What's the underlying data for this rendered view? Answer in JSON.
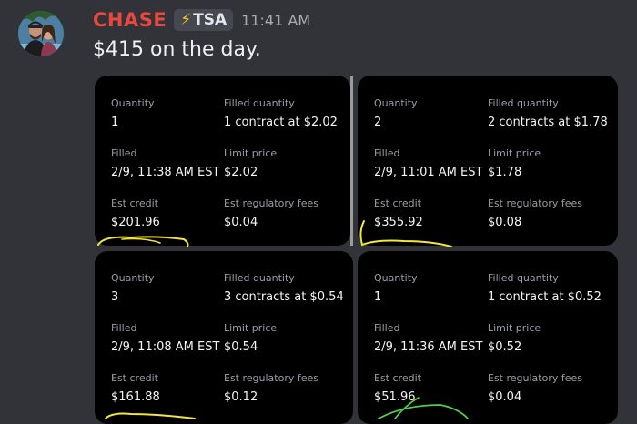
{
  "message": {
    "username": "CHASE",
    "tag_icon": "lightning-bolt-icon",
    "tag_bolt": "⚡",
    "tag_label": "TSA",
    "timestamp": "11:41 AM",
    "text": "$415 on the day."
  },
  "cards": [
    {
      "quantity_label": "Quantity",
      "quantity": "1",
      "filled_quantity_label": "Filled quantity",
      "filled_quantity": "1 contract at $2.02",
      "filled_label": "Filled",
      "filled": "2/9, 11:38 AM EST",
      "limit_label": "Limit price",
      "limit": "$2.02",
      "credit_label": "Est credit",
      "credit": "$201.96",
      "fees_label": "Est regulatory fees",
      "fees": "$0.04"
    },
    {
      "quantity_label": "Quantity",
      "quantity": "2",
      "filled_quantity_label": "Filled quantity",
      "filled_quantity": "2 contracts at $1.78",
      "filled_label": "Filled",
      "filled": "2/9, 11:01 AM EST",
      "limit_label": "Limit price",
      "limit": "$1.78",
      "credit_label": "Est credit",
      "credit": "$355.92",
      "fees_label": "Est regulatory fees",
      "fees": "$0.08"
    },
    {
      "quantity_label": "Quantity",
      "quantity": "3",
      "filled_quantity_label": "Filled quantity",
      "filled_quantity": "3 contracts at $0.54",
      "filled_label": "Filled",
      "filled": "2/9, 11:08 AM EST",
      "limit_label": "Limit price",
      "limit": "$0.54",
      "credit_label": "Est credit",
      "credit": "$161.88",
      "fees_label": "Est regulatory fees",
      "fees": "$0.12"
    },
    {
      "quantity_label": "Quantity",
      "quantity": "1",
      "filled_quantity_label": "Filled quantity",
      "filled_quantity": "1 contract at $0.52",
      "filled_label": "Filled",
      "filled": "2/9, 11:36 AM EST",
      "limit_label": "Limit price",
      "limit": "$0.52",
      "credit_label": "Est credit",
      "credit": "$51.96",
      "fees_label": "Est regulatory fees",
      "fees": "$0.04"
    }
  ],
  "colors": {
    "username": "#e8473f",
    "background": "#313338",
    "card_background": "#000000",
    "highlight_yellow": "#f1e73c",
    "highlight_green": "#4fcf4a"
  }
}
